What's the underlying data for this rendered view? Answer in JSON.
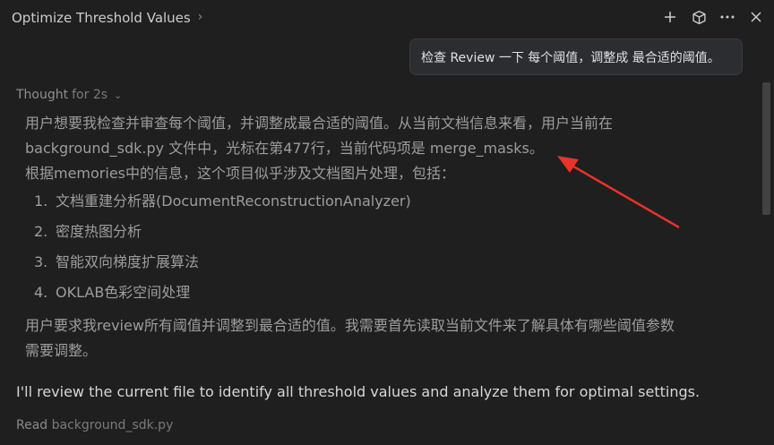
{
  "header": {
    "title": "Optimize Threshold Values",
    "actions": [
      {
        "name": "add-icon",
        "glyph": "+"
      },
      {
        "name": "cube-icon",
        "glyph": "cube"
      },
      {
        "name": "more-icon",
        "glyph": "…"
      },
      {
        "name": "close-icon",
        "glyph": "×"
      }
    ]
  },
  "user_message": "检查 Review 一下 每个阈值，调整成 最合适的阈值。",
  "thought": {
    "label": "Thought",
    "duration": "for 2s",
    "para1_line1": "用户想要我检查并审查每个阈值，并调整成最合适的阈值。从当前文档信息来看，用户当前在",
    "para1_line2": "background_sdk.py 文件中，光标在第477行，当前代码项是 merge_masks。",
    "para2": "根据memories中的信息，这个项目似乎涉及文档图片处理，包括：",
    "list": [
      {
        "num": "1.",
        "text": "文档重建分析器(DocumentReconstructionAnalyzer)"
      },
      {
        "num": "2.",
        "text": "密度热图分析"
      },
      {
        "num": "3.",
        "text": "智能双向梯度扩展算法"
      },
      {
        "num": "4.",
        "text": "OKLAB色彩空间处理"
      }
    ],
    "para3_line1": "用户要求我review所有阈值并调整到最合适的值。我需要首先读取当前文件来了解具体有哪些阈值参数",
    "para3_line2": "需要调整。"
  },
  "response": "I'll review the current file to identify all threshold values and analyze them for optimal settings.",
  "tool_call": {
    "verb": "Read",
    "file": "background_sdk.py"
  },
  "colors": {
    "background": "#1f1f1f",
    "annotation_arrow": "#e8322a"
  }
}
